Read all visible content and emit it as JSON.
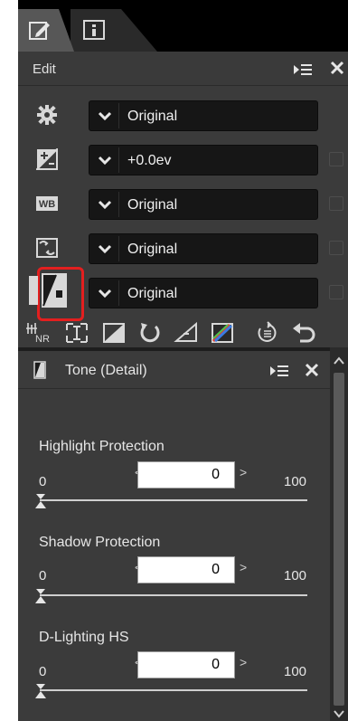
{
  "tabs": [
    {
      "name": "edit-tab",
      "icon": "edit-pencil-icon",
      "active": true
    },
    {
      "name": "info-tab",
      "icon": "info-icon",
      "active": false
    }
  ],
  "edit_panel": {
    "title": "Edit",
    "rows": [
      {
        "icon": "gear-icon",
        "value": "Original",
        "has_checkbox": false
      },
      {
        "icon": "exposure-compensation-icon",
        "value": "+0.0ev",
        "has_checkbox": true
      },
      {
        "icon": "white-balance-icon",
        "value": "Original",
        "has_checkbox": true
      },
      {
        "icon": "picture-control-icon",
        "value": "Original",
        "has_checkbox": true
      },
      {
        "icon": "tone-detail-icon",
        "value": "Original",
        "has_checkbox": true,
        "highlighted": true
      }
    ],
    "highlight_color": "#e31f1f",
    "toolbar": [
      "noise-reduction-icon",
      "crop-icon",
      "levels-curves-icon",
      "rotate-icon",
      "straighten-icon",
      "color-adjust-icon",
      "adjustment-list-icon",
      "undo-icon"
    ]
  },
  "tone_panel": {
    "title": "Tone (Detail)",
    "sections": [
      {
        "label": "Highlight Protection",
        "min": "0",
        "max": "100",
        "value": "0"
      },
      {
        "label": "Shadow Protection",
        "min": "0",
        "max": "100",
        "value": "0"
      },
      {
        "label": "D-Lighting HS",
        "min": "0",
        "max": "100",
        "value": "0"
      }
    ]
  },
  "symbols": {
    "spin_left": "<",
    "spin_right": ">"
  }
}
